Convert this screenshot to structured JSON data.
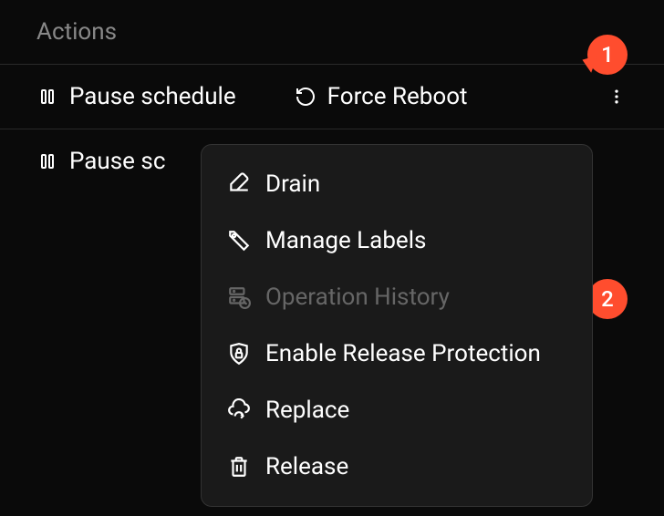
{
  "header": {
    "title": "Actions"
  },
  "rows": [
    {
      "pause_label": "Pause schedule",
      "reboot_label": "Force Reboot"
    },
    {
      "pause_label": "Pause sc"
    }
  ],
  "dropdown": {
    "items": [
      {
        "label": "Drain",
        "disabled": false
      },
      {
        "label": "Manage Labels",
        "disabled": false
      },
      {
        "label": "Operation History",
        "disabled": true
      },
      {
        "label": "Enable Release Protection",
        "disabled": false
      },
      {
        "label": "Replace",
        "disabled": false
      },
      {
        "label": "Release",
        "disabled": false
      }
    ]
  },
  "badges": {
    "b1": "1",
    "b2": "2"
  }
}
